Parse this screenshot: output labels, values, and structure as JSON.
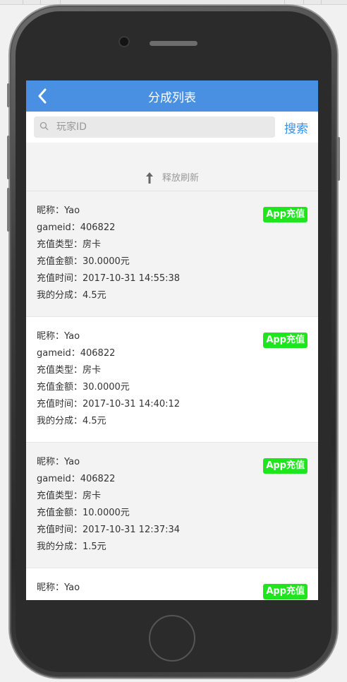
{
  "header": {
    "title": "分成列表"
  },
  "search": {
    "placeholder": "玩家ID",
    "button_label": "搜索"
  },
  "pull_refresh": {
    "label": "释放刷新"
  },
  "records": [
    {
      "nickname": "昵称：Yao",
      "gameid": "gameid：406822",
      "type": "充值类型：房卡",
      "amount": "充值金额：30.0000元",
      "time": "充值时间：2017-10-31 14:55:38",
      "share": "我的分成：4.5元",
      "badge": "App充值"
    },
    {
      "nickname": "昵称：Yao",
      "gameid": "gameid：406822",
      "type": "充值类型：房卡",
      "amount": "充值金额：30.0000元",
      "time": "充值时间：2017-10-31 14:40:12",
      "share": "我的分成：4.5元",
      "badge": "App充值"
    },
    {
      "nickname": "昵称：Yao",
      "gameid": "gameid：406822",
      "type": "充值类型：房卡",
      "amount": "充值金额：10.0000元",
      "time": "充值时间：2017-10-31 12:37:34",
      "share": "我的分成：1.5元",
      "badge": "App充值"
    },
    {
      "nickname": "昵称：Yao",
      "badge": "App充值"
    }
  ],
  "colors": {
    "nav": "#4a90e2",
    "badge": "#1ee51e",
    "link": "#3a8ee6"
  },
  "icons": {
    "back": "chevron-left-icon",
    "search": "search-icon",
    "arrow": "arrow-up-icon"
  }
}
